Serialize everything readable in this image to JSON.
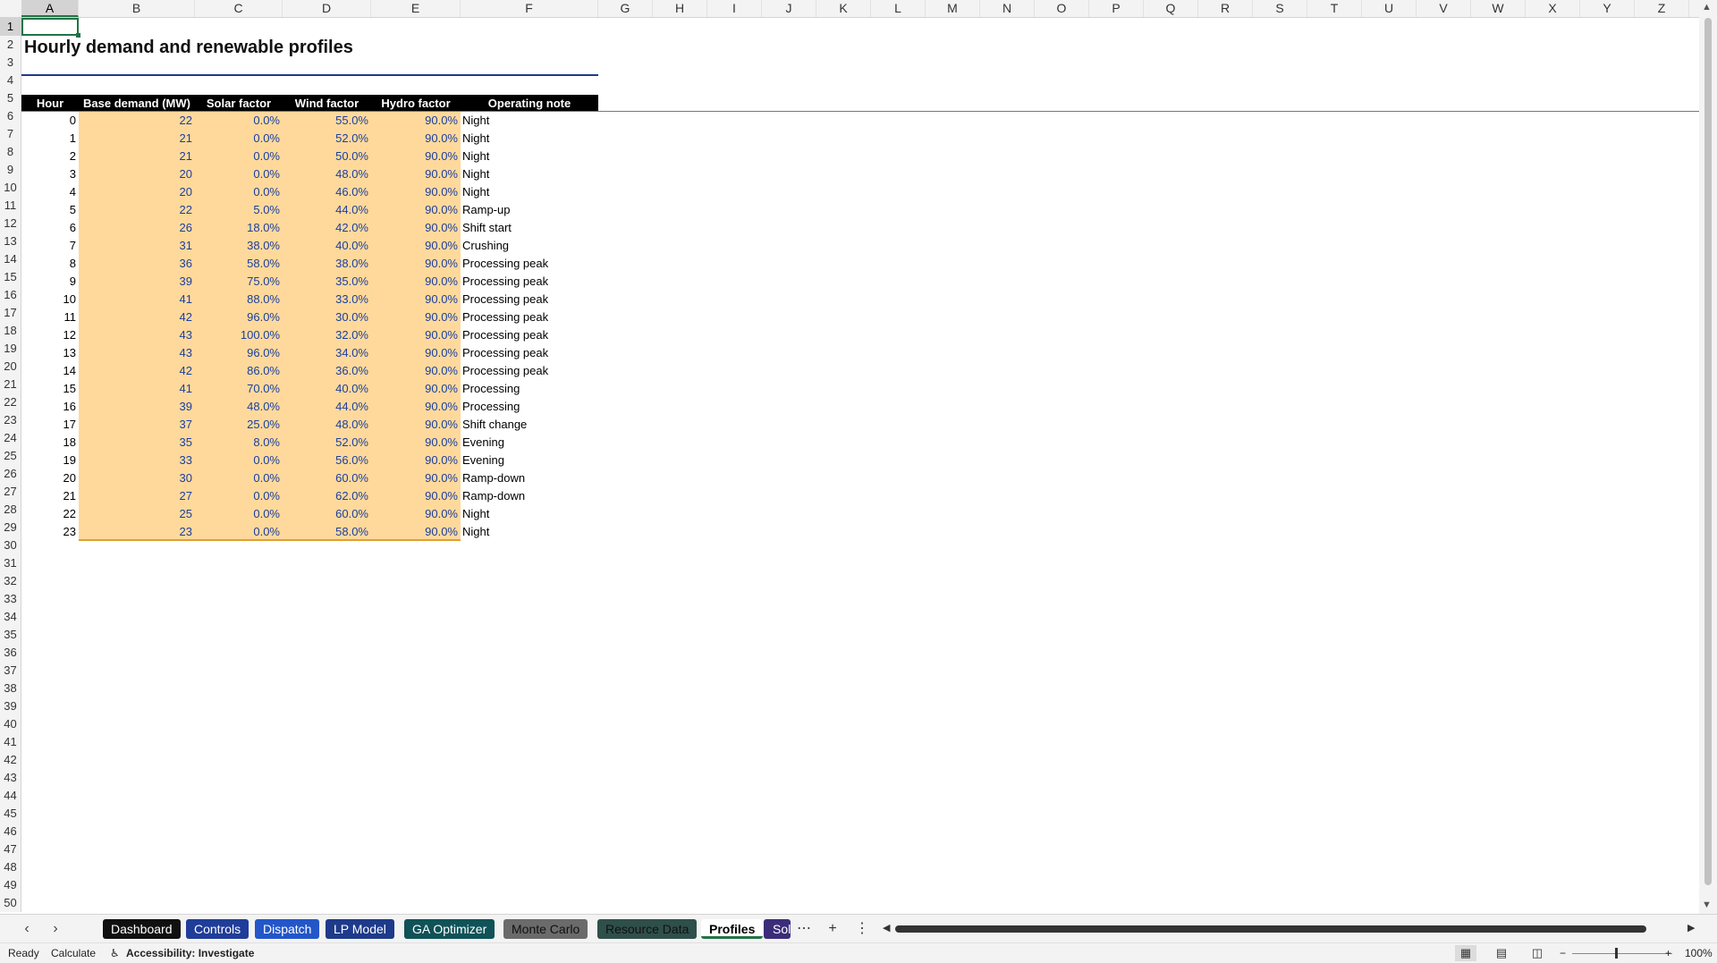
{
  "columns": [
    "A",
    "B",
    "C",
    "D",
    "E",
    "F",
    "G",
    "H",
    "I",
    "J",
    "K",
    "L",
    "M",
    "N",
    "O",
    "P",
    "Q",
    "R",
    "S",
    "T",
    "U",
    "V",
    "W",
    "X",
    "Y",
    "Z"
  ],
  "rows": [
    "1",
    "2",
    "3",
    "4",
    "5",
    "6",
    "7",
    "8",
    "9",
    "10",
    "11",
    "12",
    "13",
    "14",
    "15",
    "16",
    "17",
    "18",
    "19",
    "20",
    "21",
    "22",
    "23",
    "24",
    "25",
    "26",
    "27",
    "28",
    "29",
    "30",
    "31",
    "32",
    "33",
    "34",
    "35",
    "36",
    "37",
    "38",
    "39",
    "40",
    "41",
    "42",
    "43",
    "44",
    "45",
    "46",
    "47",
    "48",
    "49",
    "50"
  ],
  "selected_cell": "A1",
  "sheet": {
    "title": "Hourly demand and renewable profiles",
    "headers": [
      "Hour",
      "Base demand (MW)",
      "Solar factor",
      "Wind factor",
      "Hydro factor",
      "Operating note"
    ],
    "data": [
      {
        "hour": "0",
        "demand": "22",
        "solar": "0.0%",
        "wind": "55.0%",
        "hydro": "90.0%",
        "note": "Night"
      },
      {
        "hour": "1",
        "demand": "21",
        "solar": "0.0%",
        "wind": "52.0%",
        "hydro": "90.0%",
        "note": "Night"
      },
      {
        "hour": "2",
        "demand": "21",
        "solar": "0.0%",
        "wind": "50.0%",
        "hydro": "90.0%",
        "note": "Night"
      },
      {
        "hour": "3",
        "demand": "20",
        "solar": "0.0%",
        "wind": "48.0%",
        "hydro": "90.0%",
        "note": "Night"
      },
      {
        "hour": "4",
        "demand": "20",
        "solar": "0.0%",
        "wind": "46.0%",
        "hydro": "90.0%",
        "note": "Night"
      },
      {
        "hour": "5",
        "demand": "22",
        "solar": "5.0%",
        "wind": "44.0%",
        "hydro": "90.0%",
        "note": "Ramp-up"
      },
      {
        "hour": "6",
        "demand": "26",
        "solar": "18.0%",
        "wind": "42.0%",
        "hydro": "90.0%",
        "note": "Shift start"
      },
      {
        "hour": "7",
        "demand": "31",
        "solar": "38.0%",
        "wind": "40.0%",
        "hydro": "90.0%",
        "note": "Crushing"
      },
      {
        "hour": "8",
        "demand": "36",
        "solar": "58.0%",
        "wind": "38.0%",
        "hydro": "90.0%",
        "note": "Processing peak"
      },
      {
        "hour": "9",
        "demand": "39",
        "solar": "75.0%",
        "wind": "35.0%",
        "hydro": "90.0%",
        "note": "Processing peak"
      },
      {
        "hour": "10",
        "demand": "41",
        "solar": "88.0%",
        "wind": "33.0%",
        "hydro": "90.0%",
        "note": "Processing peak"
      },
      {
        "hour": "11",
        "demand": "42",
        "solar": "96.0%",
        "wind": "30.0%",
        "hydro": "90.0%",
        "note": "Processing peak"
      },
      {
        "hour": "12",
        "demand": "43",
        "solar": "100.0%",
        "wind": "32.0%",
        "hydro": "90.0%",
        "note": "Processing peak"
      },
      {
        "hour": "13",
        "demand": "43",
        "solar": "96.0%",
        "wind": "34.0%",
        "hydro": "90.0%",
        "note": "Processing peak"
      },
      {
        "hour": "14",
        "demand": "42",
        "solar": "86.0%",
        "wind": "36.0%",
        "hydro": "90.0%",
        "note": "Processing peak"
      },
      {
        "hour": "15",
        "demand": "41",
        "solar": "70.0%",
        "wind": "40.0%",
        "hydro": "90.0%",
        "note": "Processing"
      },
      {
        "hour": "16",
        "demand": "39",
        "solar": "48.0%",
        "wind": "44.0%",
        "hydro": "90.0%",
        "note": "Processing"
      },
      {
        "hour": "17",
        "demand": "37",
        "solar": "25.0%",
        "wind": "48.0%",
        "hydro": "90.0%",
        "note": "Shift change"
      },
      {
        "hour": "18",
        "demand": "35",
        "solar": "8.0%",
        "wind": "52.0%",
        "hydro": "90.0%",
        "note": "Evening"
      },
      {
        "hour": "19",
        "demand": "33",
        "solar": "0.0%",
        "wind": "56.0%",
        "hydro": "90.0%",
        "note": "Evening"
      },
      {
        "hour": "20",
        "demand": "30",
        "solar": "0.0%",
        "wind": "60.0%",
        "hydro": "90.0%",
        "note": "Ramp-down"
      },
      {
        "hour": "21",
        "demand": "27",
        "solar": "0.0%",
        "wind": "62.0%",
        "hydro": "90.0%",
        "note": "Ramp-down"
      },
      {
        "hour": "22",
        "demand": "25",
        "solar": "0.0%",
        "wind": "60.0%",
        "hydro": "90.0%",
        "note": "Night"
      },
      {
        "hour": "23",
        "demand": "23",
        "solar": "0.0%",
        "wind": "58.0%",
        "hydro": "90.0%",
        "note": "Night"
      }
    ]
  },
  "tabs": [
    {
      "label": "Dashboard",
      "bg": "#101010",
      "fg": "#ffffff"
    },
    {
      "label": "Controls",
      "bg": "#1f3d99",
      "fg": "#ffffff"
    },
    {
      "label": "Dispatch",
      "bg": "#2356c9",
      "fg": "#ffffff"
    },
    {
      "label": "LP Model",
      "bg": "#1e3a8a",
      "fg": "#ffffff"
    },
    {
      "label": "GA Optimizer",
      "bg": "#0f5257",
      "fg": "#ffffff"
    },
    {
      "label": "Monte Carlo",
      "bg": "#6b6b6b",
      "fg": "#111111"
    },
    {
      "label": "Resource Data",
      "bg": "#2f4f4a",
      "fg": "#111111"
    },
    {
      "label": "Profiles",
      "bg": "#ffffff",
      "fg": "#000000"
    },
    {
      "label": "Sol",
      "bg": "#3b2d7a",
      "fg": "#ffffff"
    }
  ],
  "active_tab": "Profiles",
  "status": {
    "ready": "Ready",
    "calculate": "Calculate",
    "accessibility": "Accessibility: Investigate",
    "zoom": "100%"
  },
  "icons": {
    "prev_sheet": "chevron-left-icon",
    "next_sheet": "chevron-right-icon",
    "more_sheets": "ellipsis-icon",
    "add_sheet": "plus-icon",
    "options": "vertical-dots-icon"
  }
}
